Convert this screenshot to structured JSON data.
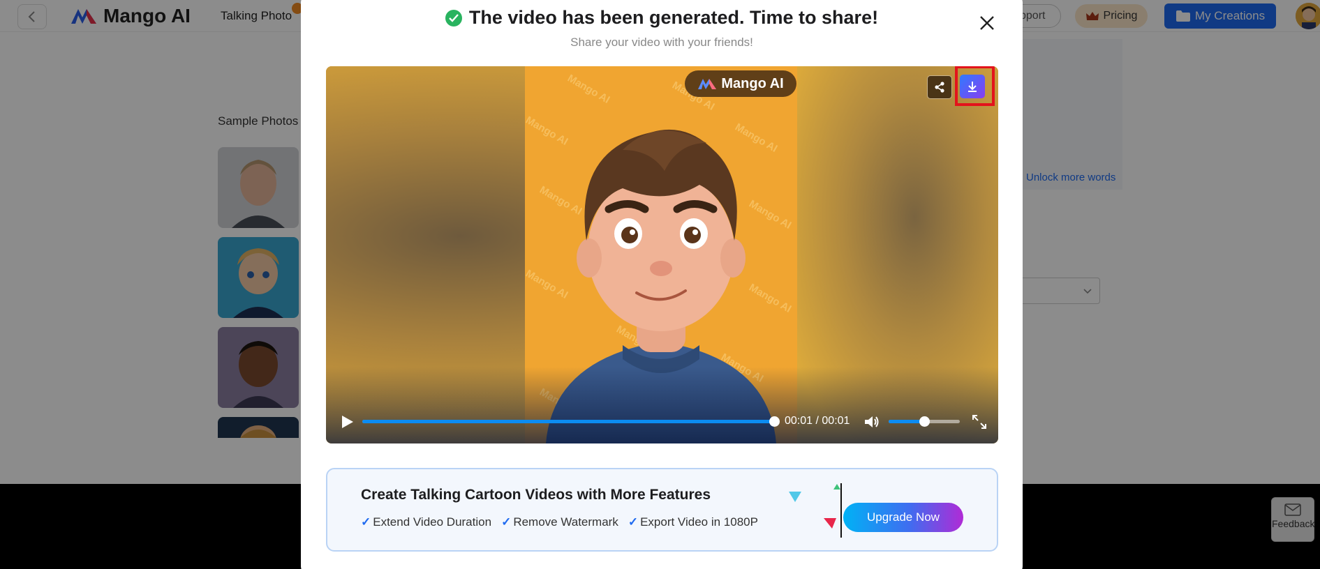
{
  "header": {
    "logo_text": "Mango AI",
    "nav_talking_photo": "Talking Photo",
    "support_label": "pport",
    "pricing_label": "Pricing",
    "my_creations_label": "My Creations"
  },
  "page": {
    "sample_photos_label": "Sample Photos",
    "unlock_more_words": "Unlock more words",
    "feedback_label": "Feedback"
  },
  "modal": {
    "title": "The video has been generated. Time to share!",
    "subtitle": "Share your video with your friends!",
    "watermark_badge": "Mango AI",
    "watermark_text": "Mango AI",
    "player": {
      "time_current": "00:01",
      "time_separator": "/",
      "time_total": "00:01",
      "progress_fraction": 1.0,
      "volume_fraction": 0.5
    },
    "promo": {
      "title": "Create Talking Cartoon Videos with More Features",
      "features": [
        "Extend Video Duration",
        "Remove Watermark",
        "Export Video in 1080P"
      ],
      "upgrade_label": "Upgrade Now"
    }
  },
  "colors": {
    "brand_blue": "#1e6af0",
    "success_green": "#29b35f",
    "highlight_red": "#e3131b",
    "video_bg": "#f0a531"
  }
}
